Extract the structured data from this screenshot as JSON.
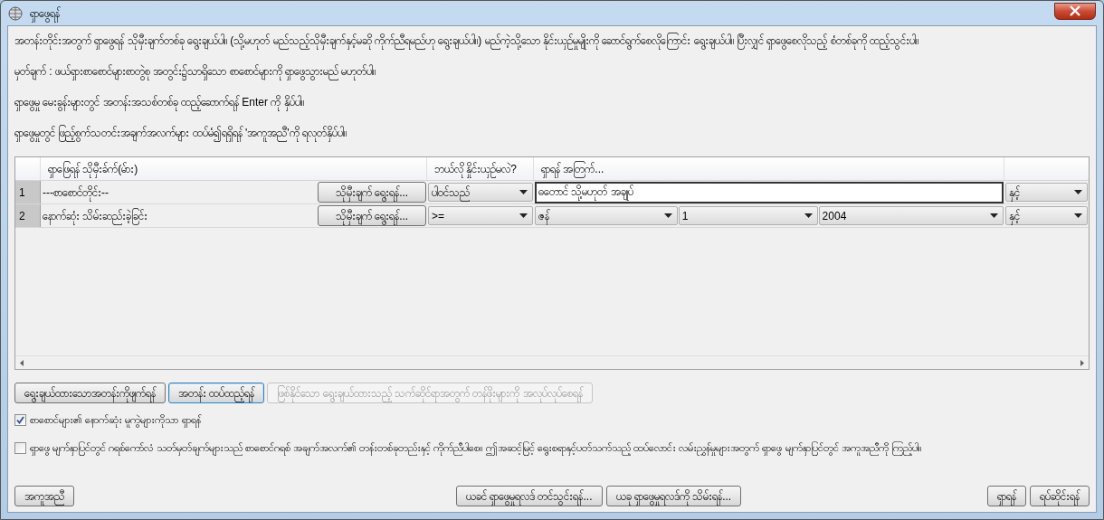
{
  "window": {
    "title": "ရှာဖွေရန်"
  },
  "instructions": [
    "အတန်းတိုင်းအတွက် ရှာဖွေရန် သိုမှီးချက်တစ်ခု ရွေးချယ်ပါ။ (သို့မဟုတ် မည်သည့်သိုမှီးချက်နှင့်မဆို ကိုက်ညီရမည်ဟု ရွေးချယ်ပါ။) မည်ကဲ့သို့သော နိုင်းယှဉ်မှုမျိုးကို ဆောင်ရွက်စေလိုကြောင်း ရွေးချယ်ပါ။ ပြီးလျှင် ရှာဖွေစေလိုသည့် စံတစ်ခုကို ထည့်သွင်းပါ။",
    "မှတ်ချက် : ဖယ်ရှားစာစောင်များစာတွဲစု အတွင်း၌သာရှိသော စာစောင်များကို ရှာဖွေသွားမည် မဟုတ်ပါ။",
    "ရှာဖွေမှု မေးခွန်းများတွင် အတန်းအသစ်တစ်ခု ထည့်ဆောက်ရန် Enter ကို နှိပ်ပါ။",
    "ရှာဖွေမှုတွင် ဖြည့်စွက်သတင်းအချက်အလက်များ ထပ်မံ၍ရရှိရန် 'အကူအညီ'ကို ရလုတ်နှိပ်ပါ။"
  ],
  "table": {
    "columns": [
      "ရှာဖြေရန် သိုမှီးခ်က်(မ်ား)",
      "ဘယ်လို နှိုင်းယှဉ်မလဲ?",
      "ရှာရန် အတြက်..."
    ],
    "rows": [
      {
        "number": "1",
        "field": "---စာစောင်တိုင်း--",
        "field_button": "သိုမှီးချက် ရွေးရန်...",
        "comparison": "ပါဝင်သည်",
        "criteria": [
          {
            "kind": "text",
            "value": "ဓတောင် သို့မဟုတ် အချုပ်"
          }
        ],
        "join": "နှင့်"
      },
      {
        "number": "2",
        "field": "နောက်ဆုံး သိမ်းဆည်းခဲ့ခြင်း",
        "field_button": "သိုမှီးချက် ရွေးရန်...",
        "comparison": ">=",
        "criteria": [
          {
            "kind": "combo",
            "value": "ဇန်"
          },
          {
            "kind": "combo",
            "value": "1"
          },
          {
            "kind": "combo",
            "value": "2004"
          }
        ],
        "join": "နှင့်"
      }
    ]
  },
  "action_buttons": [
    {
      "label": "ရွေးချယ်ထားသောအတန်းကိုဖျက်ရန်",
      "disabled": false,
      "focused": false
    },
    {
      "label": "အတန်း ထပ်ထည့်ရန်",
      "disabled": false,
      "focused": true
    },
    {
      "label": "ဖြစ်နိုင်သော ရွေးချယ်ထားသည့် သက်ဆိုင်ရာအတွက် တန်ဖိုးများကို အလုပ်လုပ်စေရန်",
      "disabled": true,
      "focused": false
    }
  ],
  "checkboxes": [
    {
      "label": "စာစောင်များ၏ နောက်ဆုံး မူကွဲများကိုသာ ရှာရန်",
      "checked": true
    },
    {
      "label": "ရှာဖွေ မျက်နှာပြင်တွင် ဂရစ်ကော်လံ သတ်မှတ်ချက်များသည် စာစောင်ဂရစ် အချက်အလက်၏ တန်းတစ်ခုတည်းနှင့် ကိုက်ညီပါစေ။ ဤအဆင့်မြင့် ရွေးစရာနှင့်ပတ်သက်သည့် ထပ်လောင်း လမ်းညွှန်မှုများအတွက် ရှာဖွေ မျက်နှာပြင်တွင် အကူအညီကို ကြည့်ပါ။",
      "checked": false
    }
  ],
  "footer": {
    "left": [
      "အကူအညီ"
    ],
    "center": [
      "ယခင် ရှာဖွေမှုရလဒ် တင်သွင်းရန်...",
      "ယခု ရှာဖွေမှုရလဒ်ကို သိမ်းရန်..."
    ],
    "right": [
      "ရှာရန်",
      "ရပ်ဆိုင်းရန်"
    ]
  }
}
